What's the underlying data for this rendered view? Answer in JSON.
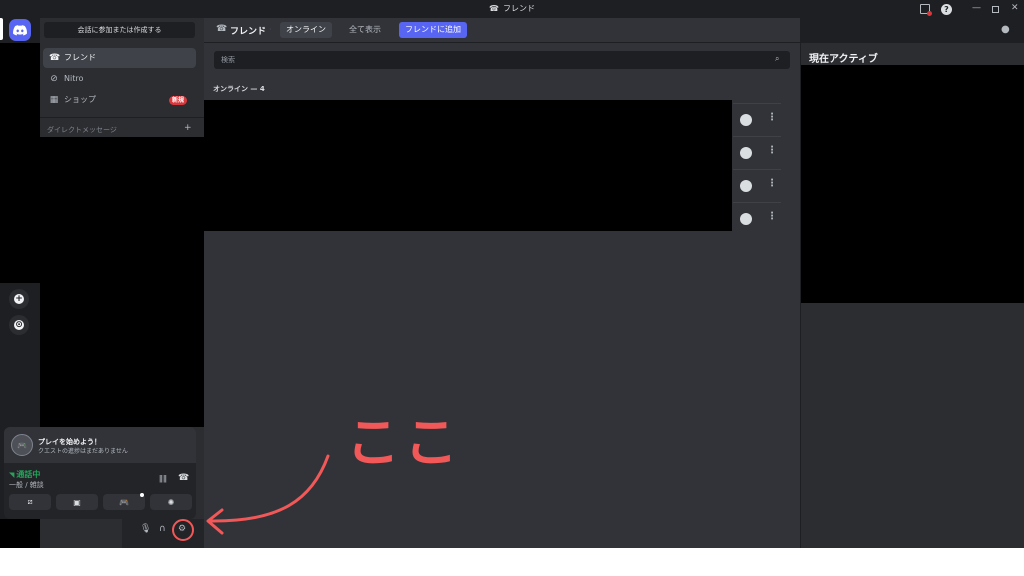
{
  "window": {
    "title": "フレンド",
    "controls": [
      "inbox-icon",
      "help-icon",
      "minimize-icon",
      "maximize-icon",
      "close-icon"
    ],
    "help_glyph": "?"
  },
  "rail": {
    "add_server": "+",
    "discover": "⊙"
  },
  "sidebar": {
    "find_conversation": "会話に参加または作成する",
    "items": [
      {
        "label": "フレンド",
        "icon": "friends-icon",
        "active": true
      },
      {
        "label": "Nitro",
        "icon": "nitro-icon",
        "active": false
      },
      {
        "label": "ショップ",
        "icon": "shop-icon",
        "active": false,
        "badge": "新規"
      }
    ],
    "dm_header": "ダイレクトメッセージ",
    "dm_add": "+"
  },
  "user_panel": {
    "quest_title": "プレイを始めよう！",
    "quest_subtitle": "クエストの進捗はまだありません",
    "voice_status": "通話中",
    "voice_channel": "一般 / 雑談",
    "voice_buttons": [
      "camera-off-icon",
      "screen-share-icon",
      "activity-icon",
      "soundboard-icon"
    ],
    "controls": [
      "mic-icon",
      "headphones-icon",
      "settings-icon"
    ]
  },
  "topbar": {
    "title": "フレンド",
    "tabs": [
      {
        "label": "オンライン",
        "active": true
      },
      {
        "label": "全て表示",
        "active": false
      }
    ],
    "add_friend": "フレンドに追加"
  },
  "friends": {
    "search_placeholder": "検索",
    "online_header": "オンライン — 4",
    "rows": 4
  },
  "active_now": {
    "title": "現在アクティブ"
  },
  "annotation": {
    "text": "ここ",
    "color": "#f25858"
  },
  "colors": {
    "brand": "#5865f2",
    "badge": "#da373c",
    "online": "#23a55a"
  }
}
